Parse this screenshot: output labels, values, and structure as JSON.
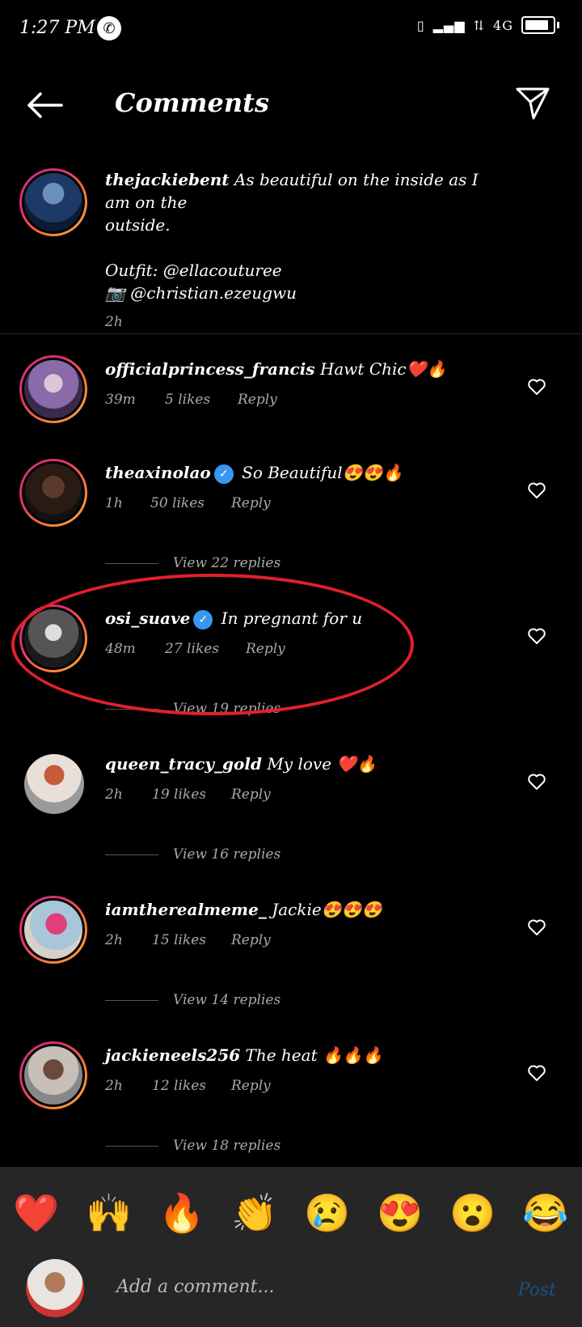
{
  "status": {
    "time": "1:27 PM",
    "network": "4G"
  },
  "header": {
    "title": "Comments"
  },
  "caption": {
    "username": "thejackiebent",
    "text_line1": "As beautiful on the inside as I am on the",
    "text_line2": "outside.",
    "outfit": "Outfit: @ellacouturee",
    "photo": "📷 @christian.ezeugwu",
    "time": "2h"
  },
  "comments": [
    {
      "username": "officialprincess_francis",
      "text": "Hawt Chic❤️🔥",
      "time": "39m",
      "likes": "5 likes",
      "reply": "Reply"
    },
    {
      "username": "theaxinolao",
      "text": "So Beautiful😍😍🔥",
      "time": "1h",
      "likes": "50 likes",
      "reply": "Reply",
      "replies": "View 22 replies"
    },
    {
      "username": "osi_suave",
      "text": "In pregnant for u",
      "time": "48m",
      "likes": "27 likes",
      "reply": "Reply",
      "replies": "View 19 replies"
    },
    {
      "username": "queen_tracy_gold",
      "text": "My love ❤️🔥",
      "time": "2h",
      "likes": "19 likes",
      "reply": "Reply",
      "replies": "View 16 replies"
    },
    {
      "username": "iamtherealmeme_",
      "text": "Jackie😍😍😍",
      "time": "2h",
      "likes": "15 likes",
      "reply": "Reply",
      "replies": "View 14 replies"
    },
    {
      "username": "jackieneels256",
      "text": "The heat 🔥🔥🔥",
      "time": "2h",
      "likes": "12 likes",
      "reply": "Reply",
      "replies": "View 18 replies"
    }
  ],
  "emoji_bar": [
    "❤️",
    "🙌",
    "🔥",
    "👏",
    "😢",
    "😍",
    "😮",
    "😂"
  ],
  "composer": {
    "placeholder": "Add a comment...",
    "post_label": "Post"
  },
  "colors": {
    "background": "#000000",
    "highlight_ring": "#e0202a",
    "verified": "#3897f0"
  }
}
